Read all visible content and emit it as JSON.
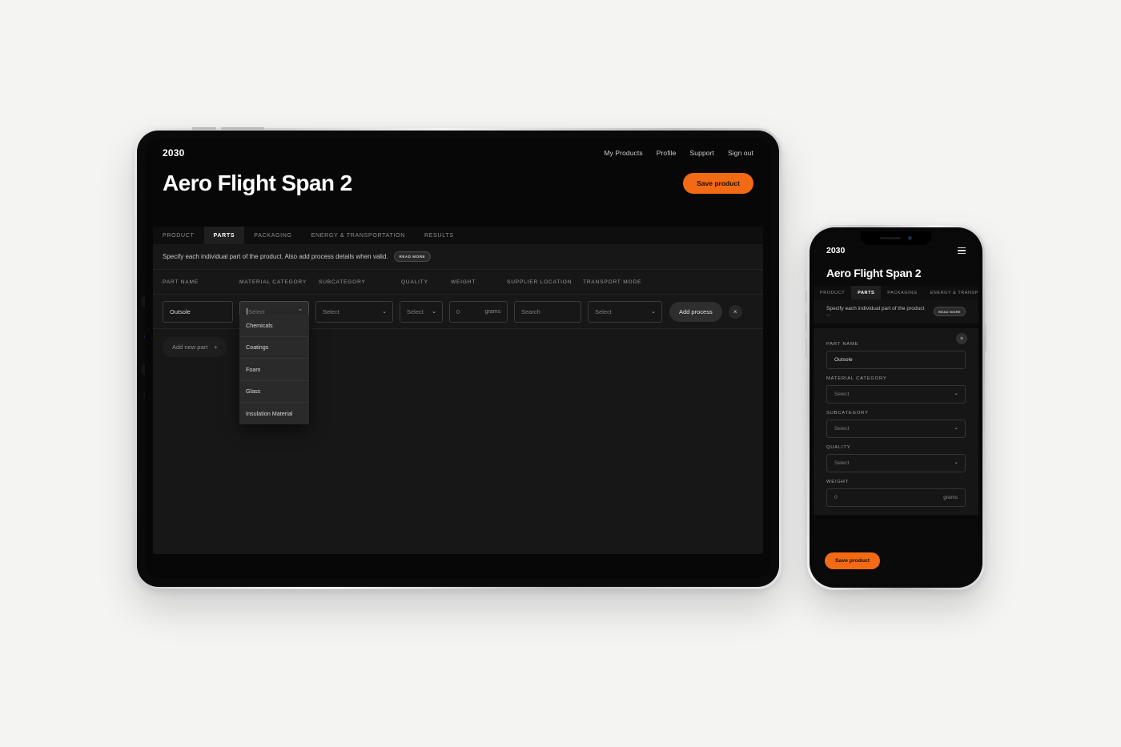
{
  "brand": {
    "logo": "2030",
    "accent": "#f26a14"
  },
  "tablet": {
    "topnav": [
      {
        "label": "My Products"
      },
      {
        "label": "Profile"
      },
      {
        "label": "Support"
      },
      {
        "label": "Sign out"
      }
    ],
    "page_title": "Aero Flight Span 2",
    "save_label": "Save product",
    "tabs": [
      {
        "label": "PRODUCT",
        "active": false
      },
      {
        "label": "PARTS",
        "active": true
      },
      {
        "label": "PACKAGING",
        "active": false
      },
      {
        "label": "ENERGY & TRANSPORTATION",
        "active": false
      },
      {
        "label": "RESULTS",
        "active": false
      }
    ],
    "notice": "Specify each individual part of the product. Also add process details when valid.",
    "read_more": "READ MORE",
    "columns": [
      "PART NAME",
      "MATERIAL CATEGORY",
      "SUBCATEGORY",
      "QUALITY",
      "WEIGHT",
      "SUPPLIER LOCATION",
      "TRANSPORT MODE"
    ],
    "row": {
      "part_name_value": "Outsole",
      "material_category_value": "Select",
      "subcategory_value": "Select",
      "quality_value": "Select",
      "weight_value": "0",
      "weight_unit": "grams",
      "supplier_location_placeholder": "Search",
      "transport_mode_value": "Select",
      "add_process_label": "Add process",
      "remove_label": "×"
    },
    "dropdown_options": [
      "Chemicals",
      "Coatings",
      "Foam",
      "Glass",
      "Insulation Material"
    ],
    "add_new_part_label": "Add new part",
    "add_new_part_icon": "+"
  },
  "phone": {
    "logo": "2030",
    "menu_icon": "hamburger-icon",
    "page_title": "Aero Flight Span 2",
    "tabs": [
      {
        "label": "PRODUCT",
        "active": false
      },
      {
        "label": "PARTS",
        "active": true
      },
      {
        "label": "PACKAGING",
        "active": false
      },
      {
        "label": "ENERGY & TRANSPORT",
        "active": false
      }
    ],
    "notice": "Specify each individual part of the product ...",
    "read_more": "READ MORE",
    "fields": [
      {
        "label": "PART NAME",
        "value": "Outsole",
        "type": "text"
      },
      {
        "label": "MATERIAL CATEGORY",
        "value": "Select",
        "type": "select"
      },
      {
        "label": "SUBCATEGORY",
        "value": "Select",
        "type": "select"
      },
      {
        "label": "QUALITY",
        "value": "Select",
        "type": "select"
      },
      {
        "label": "WEIGHT",
        "value": "0",
        "type": "number",
        "unit": "grams"
      }
    ],
    "close_label": "×",
    "save_label": "Save product"
  }
}
